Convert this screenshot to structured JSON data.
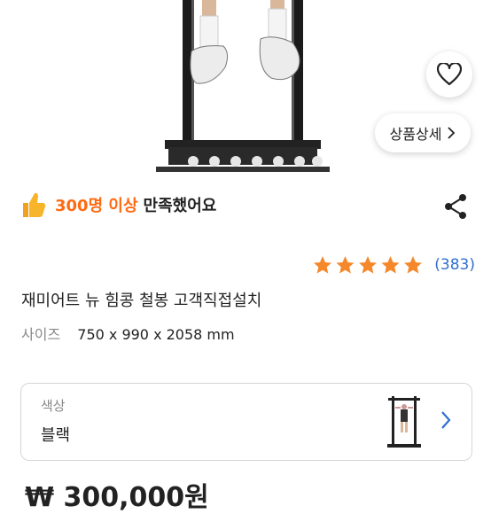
{
  "product_image": {
    "alt": "pull-up bar"
  },
  "actions": {
    "detail_label": "상품상세"
  },
  "satisfaction": {
    "highlight": "300명 이상",
    "rest": "만족했어요"
  },
  "rating": {
    "stars": 5,
    "count": "(383)"
  },
  "product": {
    "title": "재미어트 뉴 힘콩 철봉 고객직접설치",
    "size_label": "사이즈",
    "size_value": "750 x 990 x 2058 mm"
  },
  "option": {
    "label": "색상",
    "value": "블랙"
  },
  "price": {
    "text": "₩ 300,000원"
  },
  "colors": {
    "accent": "#ff6a13",
    "link": "#2f6fd1",
    "star": "#f5882a"
  }
}
